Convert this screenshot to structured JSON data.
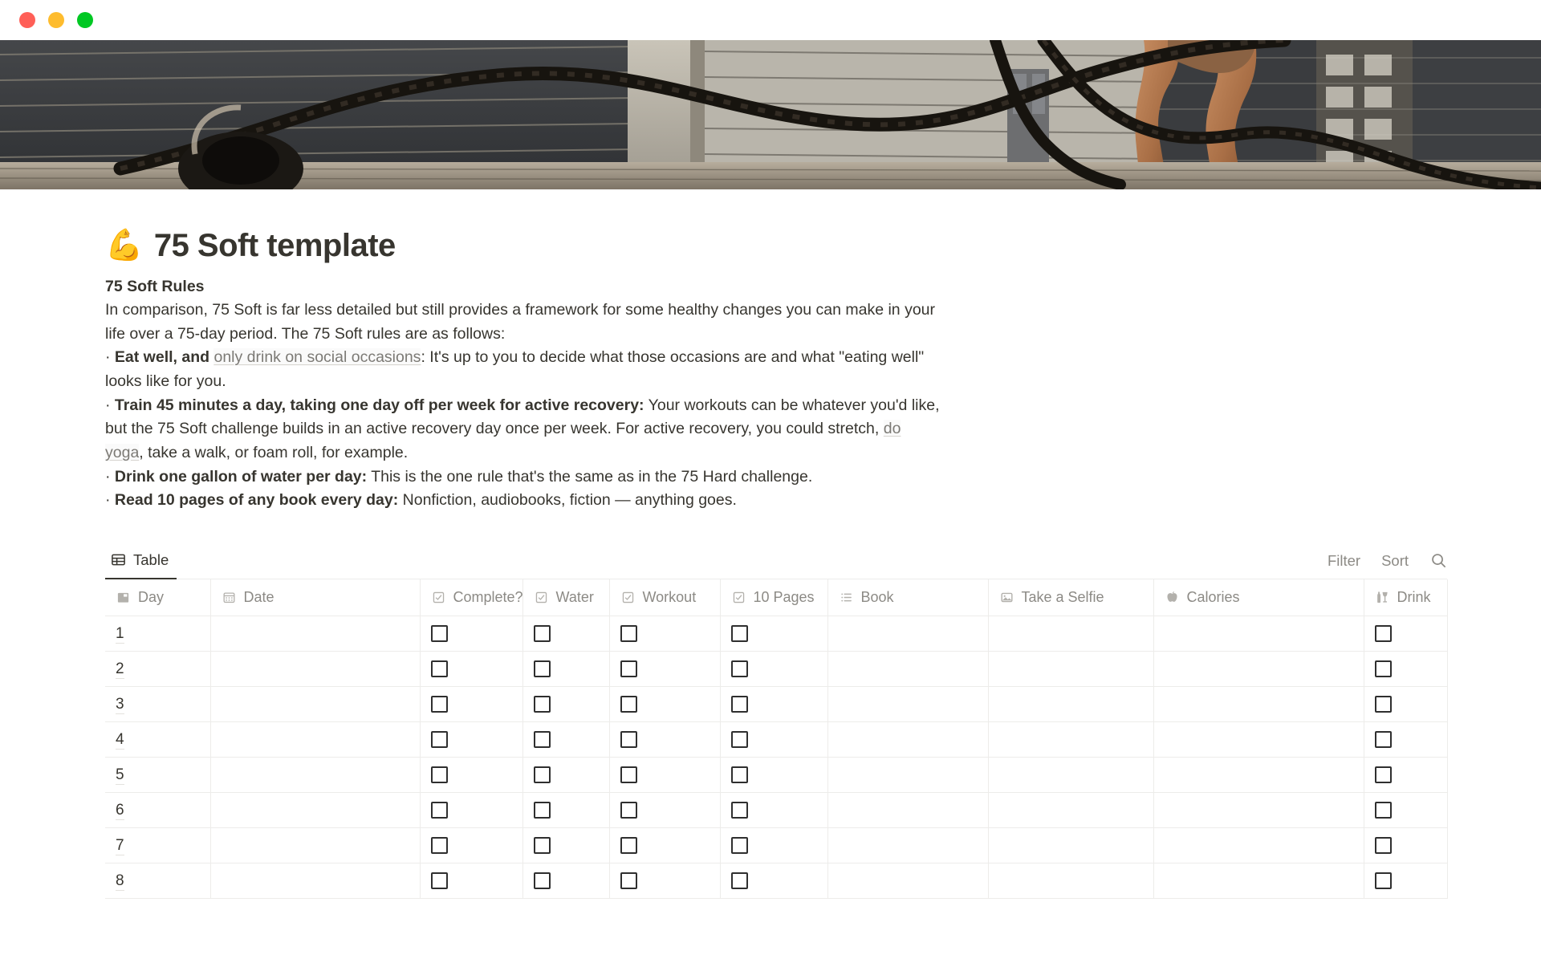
{
  "window": {
    "traffic_lights": [
      {
        "name": "close",
        "color": "#FF5F57"
      },
      {
        "name": "minimize",
        "color": "#FEBC2E"
      },
      {
        "name": "zoom",
        "color": "#00C823"
      }
    ]
  },
  "cover": {
    "alt": "battle-ropes-workout-rooftop-photo"
  },
  "page": {
    "emoji": "💪",
    "title": "75 Soft template",
    "rules_heading": "75 Soft Rules",
    "intro": "In comparison, 75 Soft is far less detailed but still provides a framework for some healthy changes you can make in your life over a 75-day period. The 75 Soft rules are as follows:",
    "bullets": [
      {
        "bullet": "·",
        "bold": "Eat well, and ",
        "link": "only drink on social occasions",
        "rest": ": It's up to you to decide what those occasions are and what \"eating well\" looks like for you."
      },
      {
        "bullet": "·",
        "bold": "Train 45 minutes a day, taking one day off per week for active recovery:",
        "rest_a": " Your workouts can be whatever you'd like, but the 75 Soft challenge builds in an active recovery day once per week. For active recovery, you could stretch, ",
        "link": "do yoga",
        "rest_b": ", take a walk, or foam roll, for example."
      },
      {
        "bullet": "·",
        "bold": "Drink one gallon of water per day:",
        "rest": " This is the one rule that's the same as in the 75 Hard challenge."
      },
      {
        "bullet": "·",
        "bold": "Read 10 pages of any book every day:",
        "rest": " Nonfiction, audiobooks, fiction — anything goes."
      }
    ]
  },
  "view": {
    "tab_label": "Table",
    "tab_icon": "table-icon",
    "filter_label": "Filter",
    "sort_label": "Sort",
    "search_icon": "search-icon"
  },
  "table": {
    "columns": [
      {
        "label": "Day",
        "icon": "title-icon",
        "type": "title"
      },
      {
        "label": "Date",
        "icon": "calendar-icon",
        "type": "date"
      },
      {
        "label": "Complete?",
        "icon": "checkbox-icon",
        "type": "checkbox"
      },
      {
        "label": "Water",
        "icon": "checkbox-icon",
        "type": "checkbox"
      },
      {
        "label": "Workout",
        "icon": "checkbox-icon",
        "type": "checkbox"
      },
      {
        "label": "10 Pages",
        "icon": "checkbox-icon",
        "type": "checkbox"
      },
      {
        "label": "Book",
        "icon": "list-icon",
        "type": "multiselect"
      },
      {
        "label": "Take a Selfie",
        "icon": "image-icon",
        "type": "files"
      },
      {
        "label": "Calories",
        "icon": "apple-icon",
        "type": "text"
      },
      {
        "label": "Drink",
        "icon": "drink-icon",
        "type": "checkbox"
      }
    ],
    "rows": [
      {
        "day": "1",
        "date": "",
        "complete": false,
        "water": false,
        "workout": false,
        "ten_pages": false,
        "book": "",
        "selfie": "",
        "calories": "",
        "drink": false
      },
      {
        "day": "2",
        "date": "",
        "complete": false,
        "water": false,
        "workout": false,
        "ten_pages": false,
        "book": "",
        "selfie": "",
        "calories": "",
        "drink": false
      },
      {
        "day": "3",
        "date": "",
        "complete": false,
        "water": false,
        "workout": false,
        "ten_pages": false,
        "book": "",
        "selfie": "",
        "calories": "",
        "drink": false
      },
      {
        "day": "4",
        "date": "",
        "complete": false,
        "water": false,
        "workout": false,
        "ten_pages": false,
        "book": "",
        "selfie": "",
        "calories": "",
        "drink": false
      },
      {
        "day": "5",
        "date": "",
        "complete": false,
        "water": false,
        "workout": false,
        "ten_pages": false,
        "book": "",
        "selfie": "",
        "calories": "",
        "drink": false
      },
      {
        "day": "6",
        "date": "",
        "complete": false,
        "water": false,
        "workout": false,
        "ten_pages": false,
        "book": "",
        "selfie": "",
        "calories": "",
        "drink": false
      },
      {
        "day": "7",
        "date": "",
        "complete": false,
        "water": false,
        "workout": false,
        "ten_pages": false,
        "book": "",
        "selfie": "",
        "calories": "",
        "drink": false
      },
      {
        "day": "8",
        "date": "",
        "complete": false,
        "water": false,
        "workout": false,
        "ten_pages": false,
        "book": "",
        "selfie": "",
        "calories": "",
        "drink": false
      }
    ]
  },
  "colors": {
    "text": "#37352F",
    "muted": "#8c8a85",
    "border": "#edecea",
    "link": "#7c7a75"
  }
}
